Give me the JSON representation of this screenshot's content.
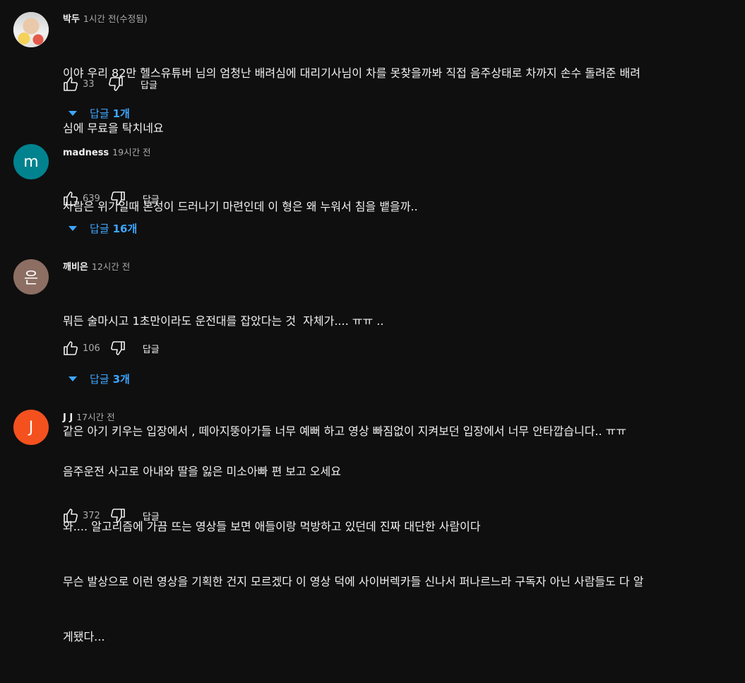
{
  "comments": [
    {
      "author": "박두",
      "time": "1시간 전(수정됨)",
      "avatar": {
        "type": "photo",
        "letter": "",
        "color": "#d9d9d9"
      },
      "lines": [
        "이야 우리 82만 헬스유튜버 님의 엄청난 배려심에 대리기사님이 차를 못찾을까봐 직접 음주상태로 차까지 손수 돌려준 배려",
        "심에 무료을 탁치네요"
      ],
      "likes": "33",
      "reply_label": "답글",
      "replies": {
        "label": "답글",
        "count": "1개"
      }
    },
    {
      "author": "madness",
      "time": "19시간 전",
      "avatar": {
        "type": "letter",
        "letter": "m",
        "color": "#00838f"
      },
      "lines": [
        "사람은 위기일때 본성이 드러나기 마련인데 이 형은 왜 누워서 침을 뱉을까.."
      ],
      "likes": "639",
      "reply_label": "답글",
      "replies": {
        "label": "답글",
        "count": "16개"
      }
    },
    {
      "author": "깨비은",
      "time": "12시간 전",
      "avatar": {
        "type": "letter",
        "letter": "은",
        "color": "#8d6e63"
      },
      "lines": [
        "뭐든 술마시고 1초만이라도 운전대를 잡았다는 것  자체가.... ㅠㅠ ..",
        "",
        "같은 아기 키우는 입장에서 , 떼아지뚱아가들 너무 예뻐 하고 영상 빠짐없이 지켜보던 입장에서 너무 안타깝습니다.. ㅠㅠ"
      ],
      "likes": "106",
      "reply_label": "답글",
      "replies": {
        "label": "답글",
        "count": "3개"
      }
    },
    {
      "author": "J J",
      "time": "17시간 전",
      "avatar": {
        "type": "letter",
        "letter": "J",
        "color": "#f4511e"
      },
      "lines": [
        "음주운전 사고로 아내와 딸을 잃은 미소아빠 편 보고 오세요",
        "와.... 알고리즘에 가끔 뜨는 영상들 보면 애들이랑 먹방하고 있던데 진짜 대단한 사람이다",
        "무슨 발상으로 이런 영상을 기획한 건지 모르겠다 이 영상 덕에 사이버렉카들 신나서 퍼나르느라 구독자 아닌 사람들도 다 알",
        "게됐다..."
      ],
      "likes": "372",
      "reply_label": "답글",
      "replies": null
    }
  ],
  "icons": {
    "like": "thumb-up-icon",
    "dislike": "thumb-down-icon",
    "expand": "caret-down-icon"
  },
  "colors": {
    "background": "#0f0f0f",
    "link": "#3ea6ff",
    "secondary_text": "#aaaaaa"
  }
}
